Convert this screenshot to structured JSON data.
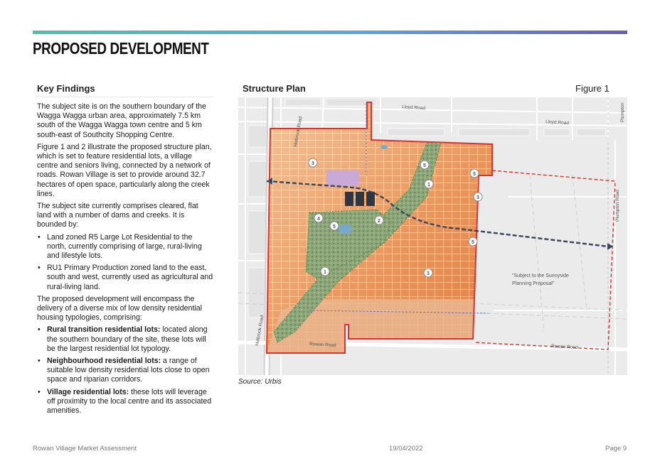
{
  "page": {
    "title": "PROPOSED DEVELOPMENT"
  },
  "left": {
    "heading": "Key Findings",
    "p1": "The subject site is on the southern boundary of the Wagga Wagga urban area, approximately 7.5 km south of the Wagga Wagga town centre and 5 km south-east of Southcity Shopping Centre.",
    "p2": "Figure 1 and 2 illustrate the proposed structure plan, which is set to feature residential lots, a village centre and seniors living, connected by a network of roads. Rowan Village is set to provide around 32.7 hectares of open space, particularly along the creek lines.",
    "p3": "The subject site currently comprises cleared, flat land with a number of dams and creeks. It is bounded by:",
    "bullets1": [
      "Land zoned R5 Large Lot Residential to the north, currently comprising of large, rural-living and lifestyle lots.",
      "RU1 Primary Production zoned land to the east, south and west, currently used as agricultural and rural-living land."
    ],
    "p4": "The proposed development will encompass the delivery of a diverse mix of low density residential housing typologies, comprising:",
    "bullets2": [
      {
        "bold": "Rural transition residential lots:",
        "text": " located along the southern boundary of the site, these lots will be the largest residential lot typology."
      },
      {
        "bold": "Neighbourhood residential lots:",
        "text": " a range of suitable low density residential lots close to open space and riparian corridors."
      },
      {
        "bold": "Village residential lots:",
        "text": " these lots will leverage off proximity to the local centre and its associated amenities."
      }
    ]
  },
  "figure": {
    "heading": "Structure Plan",
    "label": "Figure 1",
    "source": "Source: Urbis",
    "map_labels": {
      "lloyd1": "Lloyd Road",
      "lloyd2": "Lloyd Road",
      "holbrook1": "Holbrook Road",
      "holbrook2": "Holbrook Road",
      "plumpton1": "Plumpton",
      "plumpton2": "Plumpton Road",
      "rowan1": "Rowan Road",
      "rowan2": "Rowan Road",
      "note_line1": "\"Subject to the Sunnyside",
      "note_line2": "Planning Proposal\""
    },
    "markers": [
      "3",
      "5",
      "1",
      "5",
      "3",
      "4",
      "5",
      "2",
      "5",
      "1",
      "3"
    ]
  },
  "footer": {
    "left": "Rowan Village Market Assessment",
    "center": "19/04/2022",
    "right": "Page 9"
  },
  "colors": {
    "site_boundary": "#d9332f",
    "lots": "#e9a06a",
    "open_space": "#7f9a6a",
    "arrow": "#3d4a5c"
  }
}
